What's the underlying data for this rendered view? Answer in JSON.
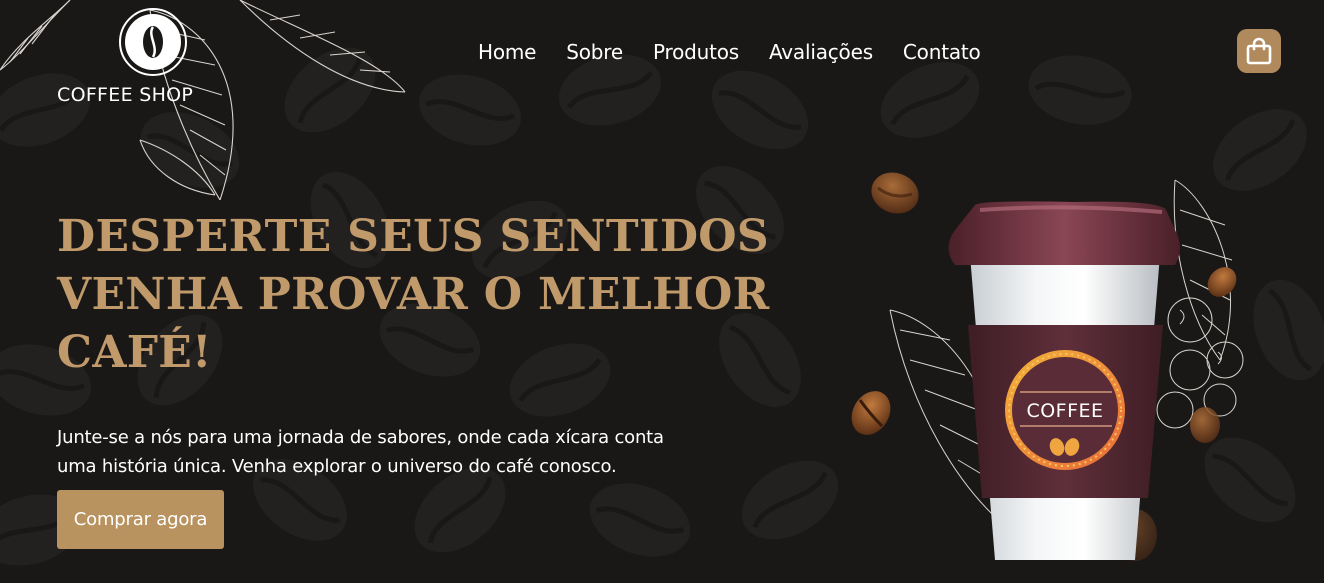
{
  "brand": {
    "name": "COFFEE SHOP"
  },
  "nav": {
    "items": [
      {
        "label": "Home"
      },
      {
        "label": "Sobre"
      },
      {
        "label": "Produtos"
      },
      {
        "label": "Avaliações"
      },
      {
        "label": "Contato"
      }
    ]
  },
  "cart": {
    "icon": "shopping-bag-icon"
  },
  "hero": {
    "title_lines": [
      "DESPERTE SEUS SENTIDOS",
      "VENHA PROVAR O MELHOR",
      "CAFÉ!"
    ],
    "description_lines": [
      "Junte-se a nós para uma jornada de sabores, onde cada xícara conta",
      "uma história única. Venha explorar o universo do café conosco."
    ],
    "cta_label": "Comprar agora",
    "cup_label": "COFFEE"
  },
  "colors": {
    "background": "#1a1817",
    "accent": "#c09a6b",
    "button": "#b8935f",
    "cup_sleeve": "#5a2d36"
  }
}
